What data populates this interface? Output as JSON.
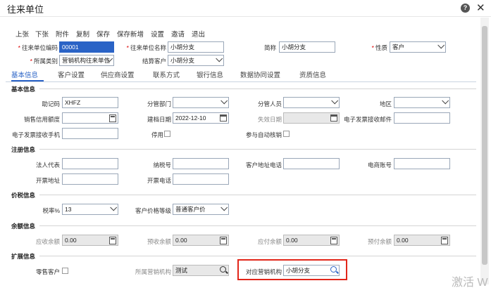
{
  "window": {
    "title": "往来单位",
    "help": "?",
    "close": "✕"
  },
  "toolbar": [
    "上张",
    "下张",
    "附件",
    "复制",
    "保存",
    "保存新增",
    "设置",
    "邀请",
    "退出"
  ],
  "header": {
    "code_label": "往来单位编码",
    "code_value": "00001",
    "name_label": "往来单位名称",
    "name_value": "小胡分支",
    "short_label": "简称",
    "short_value": "小胡分支",
    "nature_label": "性质",
    "nature_value": "客户",
    "category_label": "所属类别",
    "category_value": "营销机构往来单位",
    "settle_label": "结算客户",
    "settle_value": "小胡分支"
  },
  "tabs": [
    "基本信息",
    "客户设置",
    "供应商设置",
    "联系方式",
    "银行信息",
    "数据协同设置",
    "资质信息"
  ],
  "basic": {
    "section": "基本信息",
    "memo_label": "助记码",
    "memo_value": "XHFZ",
    "dept_label": "分管部门",
    "dept_value": "",
    "person_label": "分管人员",
    "person_value": "",
    "region_label": "地区",
    "region_value": "",
    "credit_label": "销售信用额度",
    "created_label": "建档日期",
    "created_value": "2022-12-10",
    "expire_label": "失效日期",
    "email_label": "电子发票接收邮件",
    "phone_label": "电子发票接收手机",
    "disabled_label": "停用",
    "auto_verify_label": "参与自动核销"
  },
  "register": {
    "section": "注册信息",
    "legal_label": "法人代表",
    "tax_label": "纳税号",
    "addr_phone_label": "客户地址电话",
    "ecom_label": "电商账号",
    "invoice_addr_label": "开票地址",
    "invoice_phone_label": "开票电话"
  },
  "pricetax": {
    "section": "价税信息",
    "tax_rate_label": "税率%",
    "tax_rate_value": "13",
    "price_level_label": "客户价格等级",
    "price_level_value": "普通客户价"
  },
  "balance": {
    "section": "余额信息",
    "ar_label": "应收余额",
    "ar_value": "0.00",
    "pre_recv_label": "预收余额",
    "pre_recv_value": "0.00",
    "ap_label": "应付余额",
    "ap_value": "0.00",
    "pre_pay_label": "预付余额",
    "pre_pay_value": "0.00"
  },
  "ext": {
    "section": "扩展信息",
    "retail_label": "零售客户",
    "org_label": "所属营销机构",
    "org_value": "测试",
    "mapped_label": "对应营销机构",
    "mapped_value": "小胡分支"
  },
  "watermark": "激活 W"
}
